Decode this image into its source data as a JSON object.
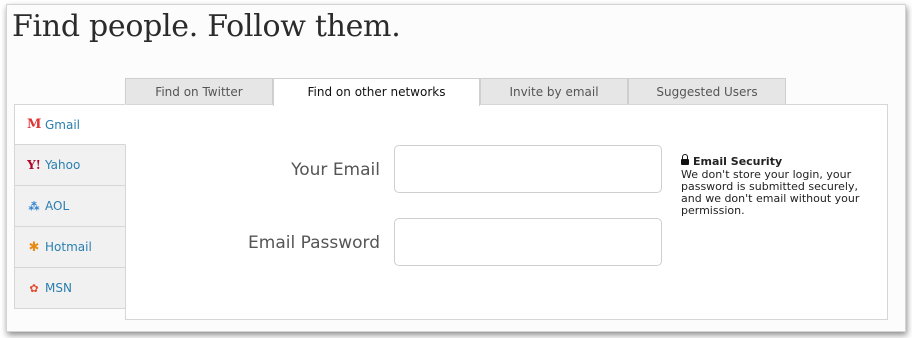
{
  "page": {
    "title": "Find people. Follow them."
  },
  "tabs": [
    {
      "label": "Find on Twitter",
      "active": false
    },
    {
      "label": "Find on other networks",
      "active": true
    },
    {
      "label": "Invite by email",
      "active": false
    },
    {
      "label": "Suggested Users",
      "active": false
    }
  ],
  "networks": [
    {
      "label": "Gmail",
      "icon": "gmail-icon",
      "glyph": "M",
      "active": true
    },
    {
      "label": "Yahoo",
      "icon": "yahoo-icon",
      "glyph": "Y!",
      "active": false
    },
    {
      "label": "AOL",
      "icon": "aol-icon",
      "glyph": "⁂",
      "active": false
    },
    {
      "label": "Hotmail",
      "icon": "hotmail-icon",
      "glyph": "✱",
      "active": false
    },
    {
      "label": "MSN",
      "icon": "msn-icon",
      "glyph": "✿",
      "active": false
    }
  ],
  "form": {
    "email_label": "Your Email",
    "email_value": "",
    "password_label": "Email Password",
    "password_value": ""
  },
  "security": {
    "title": "Email Security",
    "text": "We don't store your login, your password is submitted securely, and we don't email without your permission."
  },
  "colors": {
    "link": "#2a7fb0",
    "gmail": "#dd3333",
    "yahoo": "#b0052a",
    "aol": "#2b7fd0",
    "hotmail": "#e88b15",
    "msn": "#e34a2f"
  }
}
